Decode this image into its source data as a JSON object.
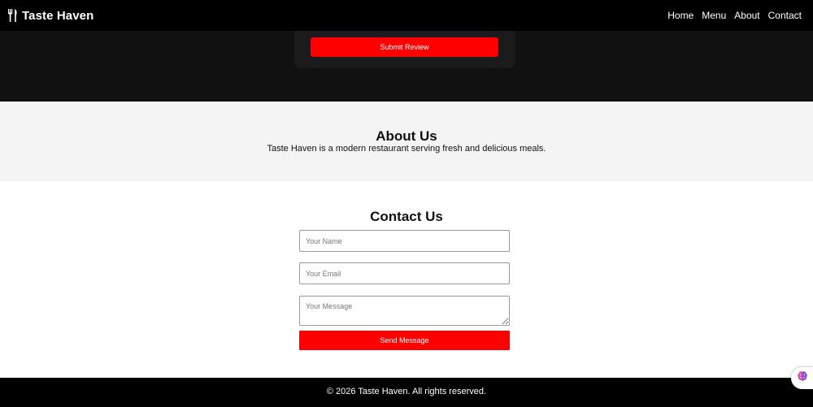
{
  "colors": {
    "navbar": "#000000",
    "review_band": "#111111",
    "accent": "#ff0000",
    "about_bg": "#f4f4f4",
    "footer": "#000000"
  },
  "navbar": {
    "brand_icon": "utensils-icon",
    "brand_name": "Taste Haven",
    "links": [
      "Home",
      "Menu",
      "About",
      "Contact"
    ]
  },
  "review": {
    "submit_label": "Submit Review"
  },
  "about": {
    "title": "About Us",
    "text": "Taste Haven is a modern restaurant serving fresh and delicious meals."
  },
  "contact": {
    "title": "Contact Us",
    "name_placeholder": "Your Name",
    "email_placeholder": "Your Email",
    "message_placeholder": "Your Message",
    "send_label": "Send Message"
  },
  "footer": {
    "text": "© 2026 Taste Haven. All rights reserved."
  },
  "widget": {
    "icon": "brain-icon"
  }
}
